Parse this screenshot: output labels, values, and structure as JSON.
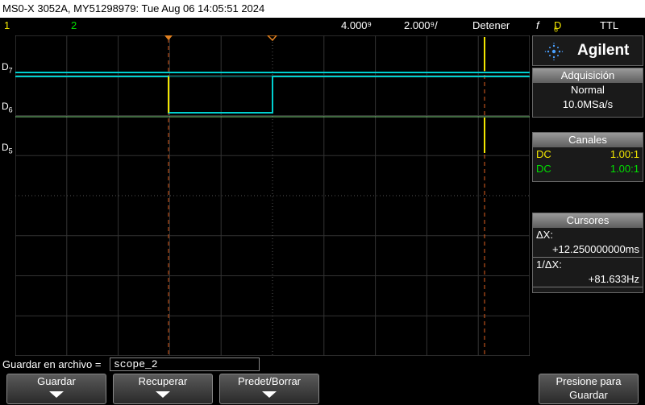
{
  "window": {
    "title": "MS0-X 3052A, MY51298979: Tue Aug 06 14:05:51 2024"
  },
  "status": {
    "ch1": "1",
    "ch2": "2",
    "timebase": "4.000⁹",
    "delay": "2.000⁹/",
    "run_state": "Detener",
    "trigger_icon": "f",
    "trigger_source": "D",
    "trigger_source_sub": "6",
    "logic": "TTL"
  },
  "digital_labels": [
    {
      "name": "D",
      "sub": "7"
    },
    {
      "name": "D",
      "sub": "6"
    },
    {
      "name": "D",
      "sub": "5"
    }
  ],
  "brand": {
    "name": "Agilent"
  },
  "acquisition": {
    "title": "Adquisición",
    "mode": "Normal",
    "rate": "10.0MSa/s"
  },
  "channels": {
    "title": "Canales",
    "rows": [
      {
        "coupling": "DC",
        "probe": "1.00:1",
        "color": "#f2e600"
      },
      {
        "coupling": "DC",
        "probe": "1.00:1",
        "color": "#00e000"
      }
    ]
  },
  "cursors": {
    "title": "Cursores",
    "dx_label": "ΔX:",
    "dx_value": "+12.250000000ms",
    "inv_label": "1/ΔX:",
    "inv_value": "+81.633Hz"
  },
  "file": {
    "label": "Guardar en archivo =",
    "value": "scope_2"
  },
  "softkeys": [
    {
      "label": "Guardar"
    },
    {
      "label": "Recuperar"
    },
    {
      "label": "Predet/Borrar"
    },
    {
      "label": "Presione para",
      "label2": "Guardar"
    }
  ],
  "colors": {
    "d7": "#00d0d0",
    "d6": "#00d0d0",
    "trace_edge": "#f2e600",
    "cursor": "#e06020",
    "grid": "#3a3a3a"
  }
}
